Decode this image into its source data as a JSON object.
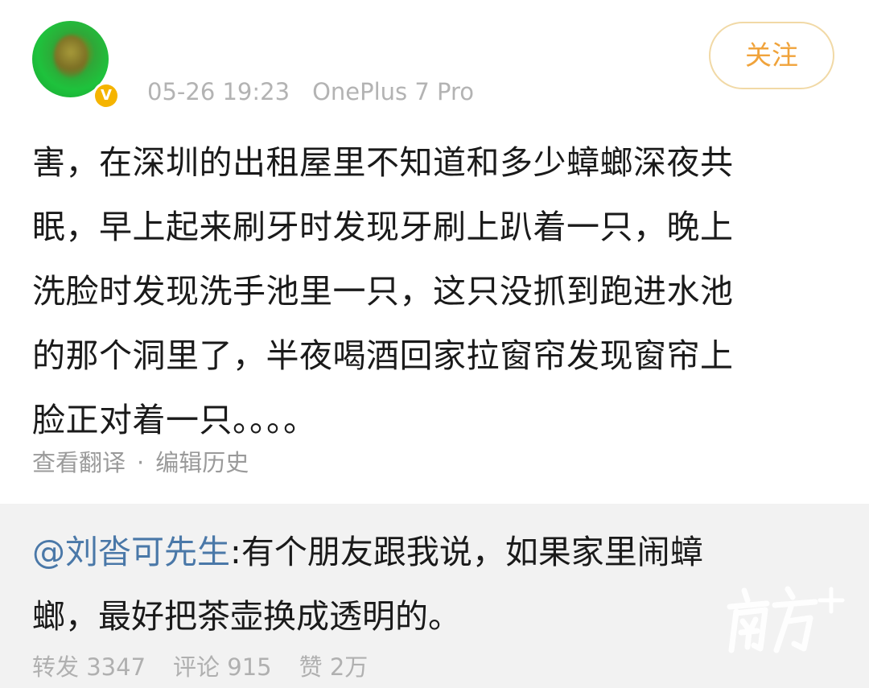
{
  "post": {
    "meta": {
      "time": "05-26 19:23",
      "device": "OnePlus 7 Pro"
    },
    "follow_label": "关注",
    "verified_badge": "V",
    "content_lines": [
      "害，在深圳的出租屋里不知道和多少蟑螂深夜共",
      "眠，早上起来刷牙时发现牙刷上趴着一只，晚上",
      "洗脸时发现洗手池里一只，这只没抓到跑进水池",
      "的那个洞里了，半夜喝酒回家拉窗帘发现窗帘上",
      "脸正对着一只。。。。"
    ],
    "actions": {
      "translate": "查看翻译",
      "separator": "·",
      "edit_history": "编辑历史"
    }
  },
  "repost": {
    "mention": "@刘沓可先生",
    "line1_text": ":有个朋友跟我说，如果家里闹蟑",
    "line2_text": "螂，最好把茶壶换成透明的。",
    "stats": {
      "forward": "转发 3347",
      "comment": "评论 915",
      "like": "赞 2万"
    }
  },
  "colors": {
    "accent": "#f0a33b",
    "mention": "#4a78a8",
    "muted": "#b3b3b3",
    "repost_bg": "#f2f2f2"
  }
}
